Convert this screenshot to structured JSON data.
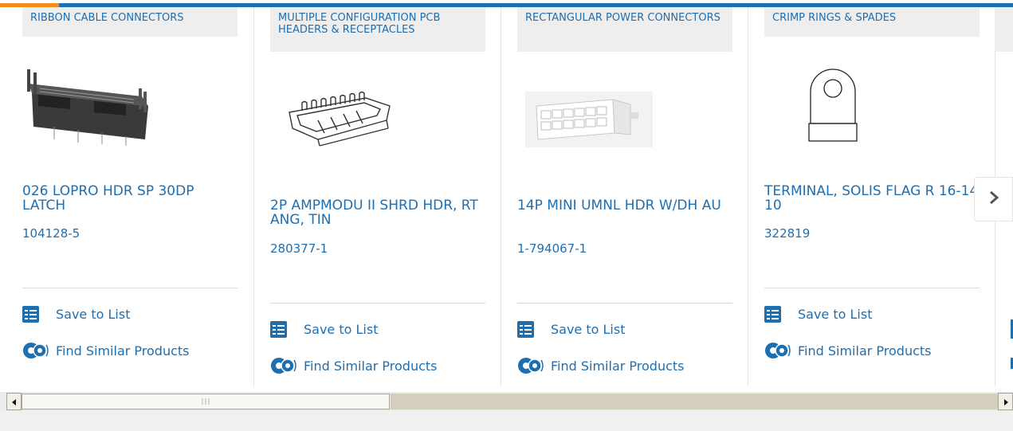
{
  "cards": [
    {
      "category": "RIBBON CABLE CONNECTORS",
      "product_name": "026 LOPRO HDR SP 30DP LATCH",
      "part_number": "104128-5",
      "save_label": "Save to List",
      "similar_label": "Find Similar Products"
    },
    {
      "category": "MULTIPLE CONFIGURATION PCB HEADERS & RECEPTACLES",
      "product_name": "2P AMPMODU II SHRD HDR, RT ANG, TIN",
      "part_number": "280377-1",
      "save_label": "Save to List",
      "similar_label": "Find Similar Products"
    },
    {
      "category": "RECTANGULAR POWER CONNECTORS",
      "product_name": "14P MINI UMNL HDR W/DH AU",
      "part_number": "1-794067-1",
      "save_label": "Save to List",
      "similar_label": "Find Similar Products"
    },
    {
      "category": "CRIMP RINGS & SPADES",
      "product_name": "TERMINAL, SOLIS FLAG R 16-14 10",
      "part_number": "322819",
      "save_label": "Save to List",
      "similar_label": "Find Similar Products"
    }
  ],
  "icons": {
    "next": "chevron-right-icon",
    "save": "checklist-icon",
    "similar": "gears-icon",
    "scroll_left": "scroll-left-arrow-icon",
    "scroll_right": "scroll-right-arrow-icon"
  },
  "colors": {
    "link": "#1e6fb0",
    "accent": "#f28a1e",
    "category_bg": "#eeeeee"
  }
}
